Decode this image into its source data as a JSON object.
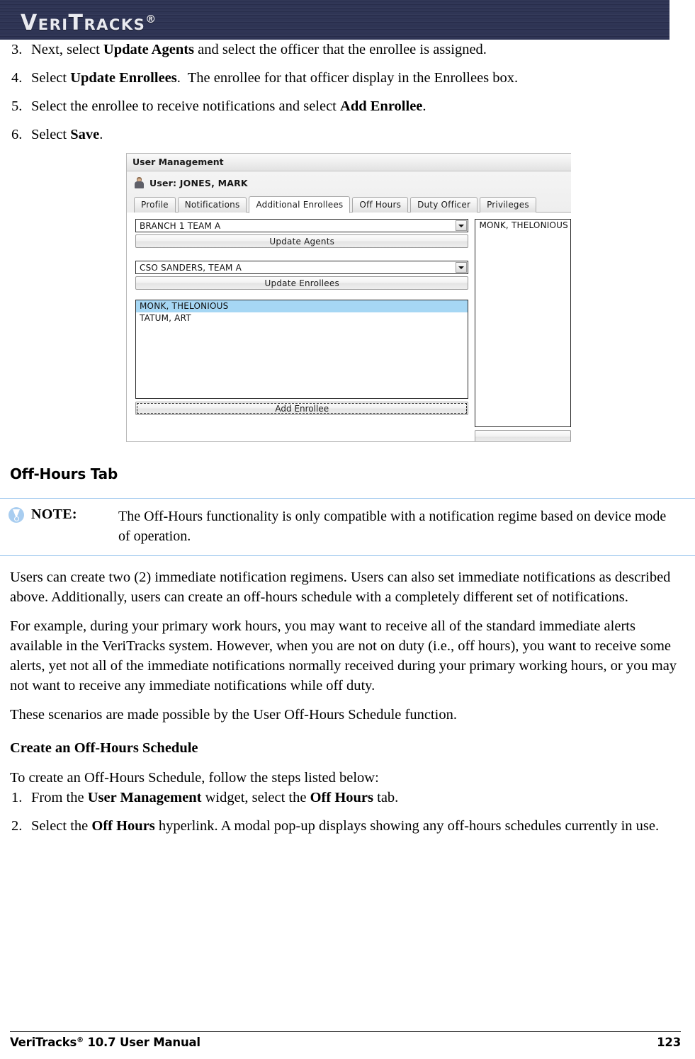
{
  "banner": {
    "logo_text": "VeriTracks",
    "logo_registered": "®"
  },
  "steps_top": [
    {
      "num": "3.",
      "html": "Next, select <b>Update Agents</b> and select the officer that the enrollee is assigned."
    },
    {
      "num": "4.",
      "html": "Select <b>Update Enrollees</b>.&nbsp; The enrollee for that officer display in the Enrollees box."
    },
    {
      "num": "5.",
      "html": "Select the enrollee to receive notifications and select <b>Add Enrollee</b>."
    },
    {
      "num": "6.",
      "html": "Select <b>Save</b>."
    }
  ],
  "screenshot": {
    "widget_title": "User Management",
    "user_label": "User: JONES, MARK",
    "tabs": [
      {
        "label": "Profile",
        "active": false
      },
      {
        "label": "Notifications",
        "active": false
      },
      {
        "label": "Additional Enrollees",
        "active": true
      },
      {
        "label": "Off Hours",
        "active": false
      },
      {
        "label": "Duty Officer",
        "active": false
      },
      {
        "label": "Privileges",
        "active": false
      }
    ],
    "agents_select": {
      "value": "BRANCH 1 TEAM A"
    },
    "update_agents_button": "Update Agents",
    "enrollees_select": {
      "value": "CSO SANDERS, TEAM A"
    },
    "update_enrollees_button": "Update Enrollees",
    "enrollee_list": [
      {
        "label": "MONK, THELONIOUS",
        "selected": true
      },
      {
        "label": "TATUM, ART",
        "selected": false
      }
    ],
    "add_enrollee_button": "Add Enrollee",
    "right_list": [
      {
        "label": "MONK, THELONIOUS"
      }
    ],
    "highlight_color": "#a6d7f4"
  },
  "section": {
    "heading": "Off-Hours Tab"
  },
  "note": {
    "label": "NOTE:",
    "text": "The Off-Hours functionality is only compatible with a notification regime based on device mode of operation."
  },
  "paragraphs": {
    "p1": "Users can create two (2) immediate notification regimens. Users can also set immediate notifications as described above. Additionally, users can create an off-hours schedule with a completely different set of notifications.",
    "p2": "For example, during your primary work hours, you may want to receive all of the standard immediate alerts available in the VeriTracks system. However, when you are not on duty (i.e., off hours), you want to receive some alerts, yet not all of the immediate notifications normally received during your primary working hours, or you may not want to receive any immediate notifications while off duty.",
    "p3": "These scenarios are made possible by the User Off-Hours Schedule function.",
    "subheading": "Create an Off-Hours Schedule",
    "p4": "To create an Off-Hours Schedule, follow the steps listed below:"
  },
  "steps_bottom": [
    {
      "num": "1.",
      "html": "From the <b>User Management</b> widget, select the <b>Off Hours</b> tab."
    },
    {
      "num": "2.",
      "html": "Select the <b>Off Hours</b> hyperlink. A modal pop-up displays showing any off-hours schedules currently in use."
    }
  ],
  "footer": {
    "left_pre": "VeriTracks",
    "left_reg": "®",
    "left_post": " 10.7 User Manual",
    "page_number": "123"
  }
}
